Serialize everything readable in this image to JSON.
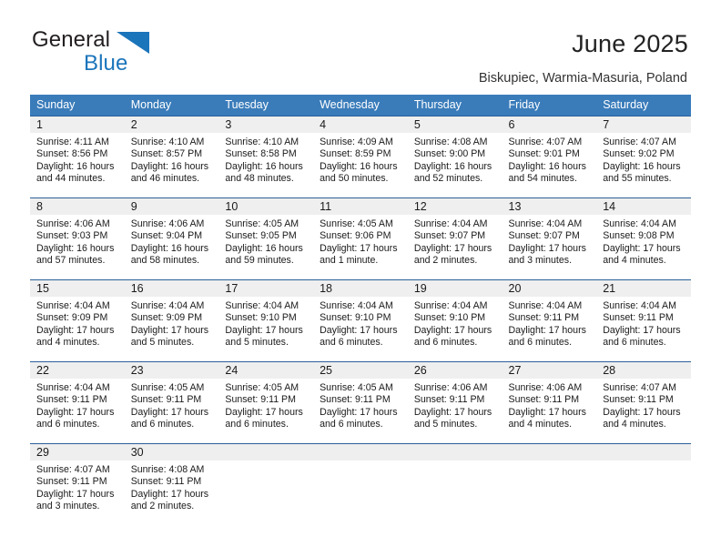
{
  "brand": {
    "line1": "General",
    "line2": "Blue",
    "mark": "triangle-logo-mark"
  },
  "header": {
    "title": "June 2025",
    "location": "Biskupiec, Warmia-Masuria, Poland"
  },
  "colors": {
    "header_blue": "#3a7cba",
    "row_divider_blue": "#2a6099",
    "daynum_band_gray": "#efefef",
    "brand_blue": "#1b75bb",
    "text": "#1a1a1a"
  },
  "weekdays": [
    "Sunday",
    "Monday",
    "Tuesday",
    "Wednesday",
    "Thursday",
    "Friday",
    "Saturday"
  ],
  "weeks": [
    [
      {
        "day": "1",
        "sunrise": "Sunrise: 4:11 AM",
        "sunset": "Sunset: 8:56 PM",
        "daylight": "Daylight: 16 hours and 44 minutes."
      },
      {
        "day": "2",
        "sunrise": "Sunrise: 4:10 AM",
        "sunset": "Sunset: 8:57 PM",
        "daylight": "Daylight: 16 hours and 46 minutes."
      },
      {
        "day": "3",
        "sunrise": "Sunrise: 4:10 AM",
        "sunset": "Sunset: 8:58 PM",
        "daylight": "Daylight: 16 hours and 48 minutes."
      },
      {
        "day": "4",
        "sunrise": "Sunrise: 4:09 AM",
        "sunset": "Sunset: 8:59 PM",
        "daylight": "Daylight: 16 hours and 50 minutes."
      },
      {
        "day": "5",
        "sunrise": "Sunrise: 4:08 AM",
        "sunset": "Sunset: 9:00 PM",
        "daylight": "Daylight: 16 hours and 52 minutes."
      },
      {
        "day": "6",
        "sunrise": "Sunrise: 4:07 AM",
        "sunset": "Sunset: 9:01 PM",
        "daylight": "Daylight: 16 hours and 54 minutes."
      },
      {
        "day": "7",
        "sunrise": "Sunrise: 4:07 AM",
        "sunset": "Sunset: 9:02 PM",
        "daylight": "Daylight: 16 hours and 55 minutes."
      }
    ],
    [
      {
        "day": "8",
        "sunrise": "Sunrise: 4:06 AM",
        "sunset": "Sunset: 9:03 PM",
        "daylight": "Daylight: 16 hours and 57 minutes."
      },
      {
        "day": "9",
        "sunrise": "Sunrise: 4:06 AM",
        "sunset": "Sunset: 9:04 PM",
        "daylight": "Daylight: 16 hours and 58 minutes."
      },
      {
        "day": "10",
        "sunrise": "Sunrise: 4:05 AM",
        "sunset": "Sunset: 9:05 PM",
        "daylight": "Daylight: 16 hours and 59 minutes."
      },
      {
        "day": "11",
        "sunrise": "Sunrise: 4:05 AM",
        "sunset": "Sunset: 9:06 PM",
        "daylight": "Daylight: 17 hours and 1 minute."
      },
      {
        "day": "12",
        "sunrise": "Sunrise: 4:04 AM",
        "sunset": "Sunset: 9:07 PM",
        "daylight": "Daylight: 17 hours and 2 minutes."
      },
      {
        "day": "13",
        "sunrise": "Sunrise: 4:04 AM",
        "sunset": "Sunset: 9:07 PM",
        "daylight": "Daylight: 17 hours and 3 minutes."
      },
      {
        "day": "14",
        "sunrise": "Sunrise: 4:04 AM",
        "sunset": "Sunset: 9:08 PM",
        "daylight": "Daylight: 17 hours and 4 minutes."
      }
    ],
    [
      {
        "day": "15",
        "sunrise": "Sunrise: 4:04 AM",
        "sunset": "Sunset: 9:09 PM",
        "daylight": "Daylight: 17 hours and 4 minutes."
      },
      {
        "day": "16",
        "sunrise": "Sunrise: 4:04 AM",
        "sunset": "Sunset: 9:09 PM",
        "daylight": "Daylight: 17 hours and 5 minutes."
      },
      {
        "day": "17",
        "sunrise": "Sunrise: 4:04 AM",
        "sunset": "Sunset: 9:10 PM",
        "daylight": "Daylight: 17 hours and 5 minutes."
      },
      {
        "day": "18",
        "sunrise": "Sunrise: 4:04 AM",
        "sunset": "Sunset: 9:10 PM",
        "daylight": "Daylight: 17 hours and 6 minutes."
      },
      {
        "day": "19",
        "sunrise": "Sunrise: 4:04 AM",
        "sunset": "Sunset: 9:10 PM",
        "daylight": "Daylight: 17 hours and 6 minutes."
      },
      {
        "day": "20",
        "sunrise": "Sunrise: 4:04 AM",
        "sunset": "Sunset: 9:11 PM",
        "daylight": "Daylight: 17 hours and 6 minutes."
      },
      {
        "day": "21",
        "sunrise": "Sunrise: 4:04 AM",
        "sunset": "Sunset: 9:11 PM",
        "daylight": "Daylight: 17 hours and 6 minutes."
      }
    ],
    [
      {
        "day": "22",
        "sunrise": "Sunrise: 4:04 AM",
        "sunset": "Sunset: 9:11 PM",
        "daylight": "Daylight: 17 hours and 6 minutes."
      },
      {
        "day": "23",
        "sunrise": "Sunrise: 4:05 AM",
        "sunset": "Sunset: 9:11 PM",
        "daylight": "Daylight: 17 hours and 6 minutes."
      },
      {
        "day": "24",
        "sunrise": "Sunrise: 4:05 AM",
        "sunset": "Sunset: 9:11 PM",
        "daylight": "Daylight: 17 hours and 6 minutes."
      },
      {
        "day": "25",
        "sunrise": "Sunrise: 4:05 AM",
        "sunset": "Sunset: 9:11 PM",
        "daylight": "Daylight: 17 hours and 6 minutes."
      },
      {
        "day": "26",
        "sunrise": "Sunrise: 4:06 AM",
        "sunset": "Sunset: 9:11 PM",
        "daylight": "Daylight: 17 hours and 5 minutes."
      },
      {
        "day": "27",
        "sunrise": "Sunrise: 4:06 AM",
        "sunset": "Sunset: 9:11 PM",
        "daylight": "Daylight: 17 hours and 4 minutes."
      },
      {
        "day": "28",
        "sunrise": "Sunrise: 4:07 AM",
        "sunset": "Sunset: 9:11 PM",
        "daylight": "Daylight: 17 hours and 4 minutes."
      }
    ],
    [
      {
        "day": "29",
        "sunrise": "Sunrise: 4:07 AM",
        "sunset": "Sunset: 9:11 PM",
        "daylight": "Daylight: 17 hours and 3 minutes."
      },
      {
        "day": "30",
        "sunrise": "Sunrise: 4:08 AM",
        "sunset": "Sunset: 9:11 PM",
        "daylight": "Daylight: 17 hours and 2 minutes."
      },
      {
        "day": "",
        "sunrise": "",
        "sunset": "",
        "daylight": ""
      },
      {
        "day": "",
        "sunrise": "",
        "sunset": "",
        "daylight": ""
      },
      {
        "day": "",
        "sunrise": "",
        "sunset": "",
        "daylight": ""
      },
      {
        "day": "",
        "sunrise": "",
        "sunset": "",
        "daylight": ""
      },
      {
        "day": "",
        "sunrise": "",
        "sunset": "",
        "daylight": ""
      }
    ]
  ]
}
